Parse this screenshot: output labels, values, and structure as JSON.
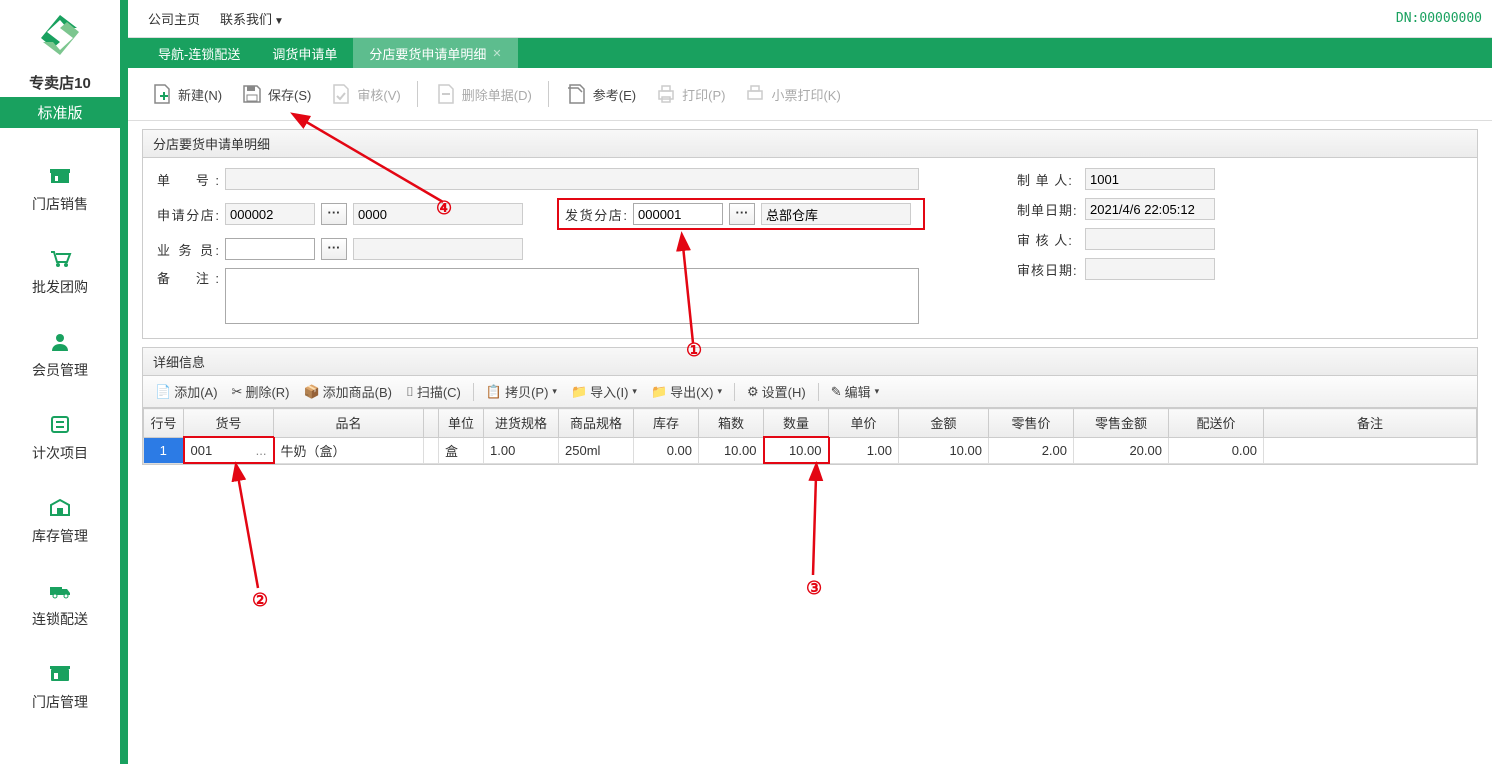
{
  "sidebar": {
    "store_name": "专卖店10",
    "edition": "标准版",
    "items": [
      {
        "label": "门店销售",
        "icon": "store-icon"
      },
      {
        "label": "批发团购",
        "icon": "cart-icon"
      },
      {
        "label": "会员管理",
        "icon": "member-icon"
      },
      {
        "label": "计次项目",
        "icon": "count-icon"
      },
      {
        "label": "库存管理",
        "icon": "stock-icon"
      },
      {
        "label": "连锁配送",
        "icon": "delivery-icon"
      },
      {
        "label": "门店管理",
        "icon": "settings-icon"
      }
    ]
  },
  "topmenu": {
    "items": [
      "公司主页",
      "联系我们"
    ],
    "dn": "DN:00000000"
  },
  "tabs": {
    "items": [
      {
        "label": "导航-连锁配送"
      },
      {
        "label": "调货申请单"
      },
      {
        "label": "分店要货申请单明细",
        "active": true
      }
    ]
  },
  "toolbar": {
    "new": "新建(N)",
    "save": "保存(S)",
    "audit": "审核(V)",
    "delete": "删除单据(D)",
    "ref": "参考(E)",
    "print": "打印(P)",
    "receipt": "小票打印(K)"
  },
  "form": {
    "title": "分店要货申请单明细",
    "labels": {
      "no": "单　号:",
      "apply_store": "申请分店:",
      "salesman": "业 务 员:",
      "remark": "备　注:",
      "ship_store": "发货分店:",
      "maker": "制 单 人:",
      "make_date": "制单日期:",
      "auditor": "审 核 人:",
      "audit_date": "审核日期:"
    },
    "values": {
      "no": "",
      "apply_code": "000002",
      "apply_name": "0000",
      "salesman": "",
      "remark": "",
      "ship_code": "000001",
      "ship_name": "总部仓库",
      "maker": "1001",
      "make_date": "2021/4/6 22:05:12",
      "auditor": "",
      "audit_date": ""
    }
  },
  "detail": {
    "title": "详细信息",
    "toolbar": {
      "add": "添加(A)",
      "del": "删除(R)",
      "add_goods": "添加商品(B)",
      "scan": "扫描(C)",
      "copy": "拷贝(P)",
      "import": "导入(I)",
      "export": "导出(X)",
      "setting": "设置(H)",
      "edit": "编辑"
    },
    "columns": [
      "行号",
      "货号",
      "品名",
      "",
      "单位",
      "进货规格",
      "商品规格",
      "库存",
      "箱数",
      "数量",
      "单价",
      "金额",
      "零售价",
      "零售金额",
      "配送价",
      "备注"
    ],
    "row": {
      "rownum": "1",
      "code": "001",
      "code_suffix": "...",
      "name": "牛奶（盒）",
      "unit": "盒",
      "in_spec": "1.00",
      "spec": "250ml",
      "stock": "0.00",
      "box": "10.00",
      "qty": "10.00",
      "price": "1.00",
      "amount": "10.00",
      "retail": "2.00",
      "retail_amt": "20.00",
      "dist_price": "0.00",
      "remark": ""
    }
  },
  "annotations": {
    "1": "①",
    "2": "②",
    "3": "③",
    "4": "④"
  }
}
